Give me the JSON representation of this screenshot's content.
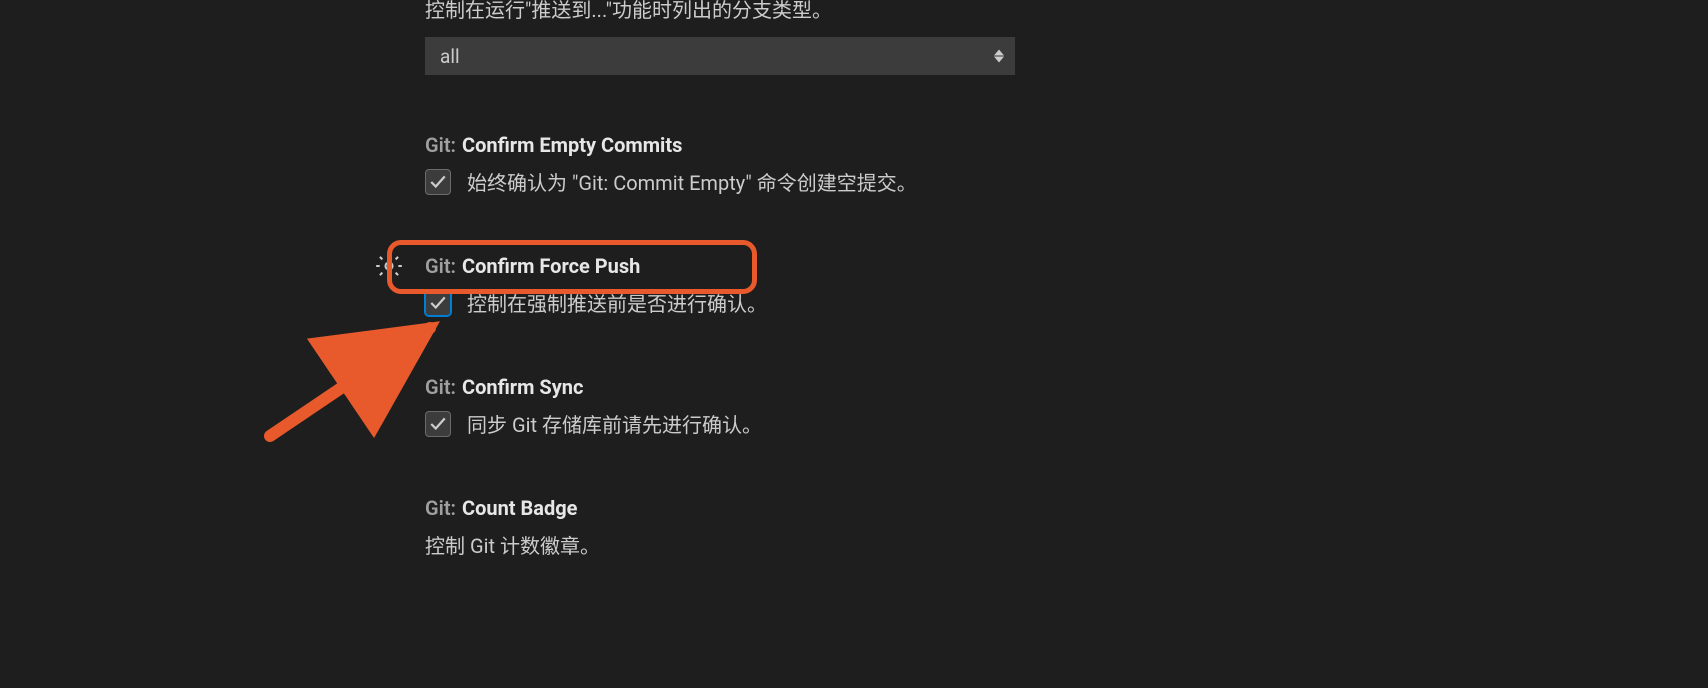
{
  "settings": {
    "push_to_branch_types": {
      "description": "控制在运行\"推送到...\"功能时列出的分支类型。",
      "selected": "all"
    },
    "confirm_empty_commits": {
      "prefix": "Git:",
      "name": "Confirm Empty Commits",
      "description": "始终确认为 \"Git: Commit Empty\" 命令创建空提交。",
      "checked": true
    },
    "confirm_force_push": {
      "prefix": "Git:",
      "name": "Confirm Force Push",
      "description": "控制在强制推送前是否进行确认。",
      "checked": true
    },
    "confirm_sync": {
      "prefix": "Git:",
      "name": "Confirm Sync",
      "description": "同步 Git 存储库前请先进行确认。",
      "checked": true
    },
    "count_badge": {
      "prefix": "Git:",
      "name": "Count Badge",
      "description": "控制 Git 计数徽章。"
    }
  }
}
